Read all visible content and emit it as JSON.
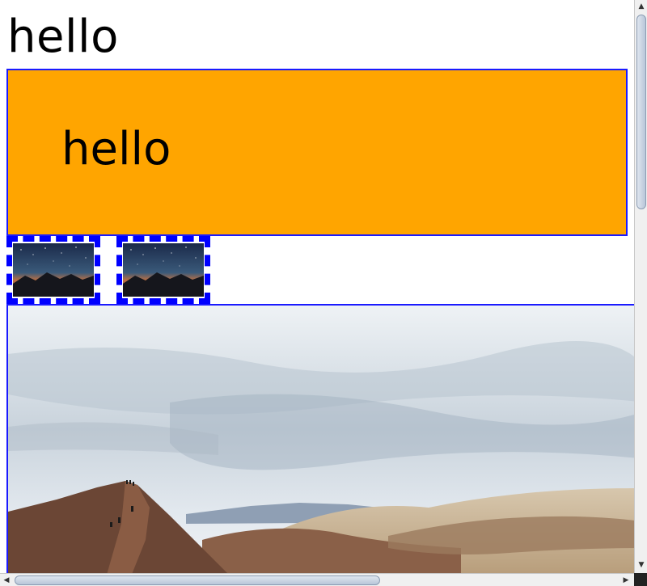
{
  "page": {
    "heading": "hello",
    "orange_box_text": "hello"
  },
  "thumbnails": [
    {
      "name": "night-sky-thumbnail-1"
    },
    {
      "name": "night-sky-thumbnail-2"
    }
  ],
  "colors": {
    "orange": "#ffa500",
    "border_blue": "#0000ff"
  },
  "scrollbars": {
    "vertical_arrow_up": "▲",
    "vertical_arrow_down": "▼",
    "horizontal_arrow_left": "◀",
    "horizontal_arrow_right": "▶"
  }
}
